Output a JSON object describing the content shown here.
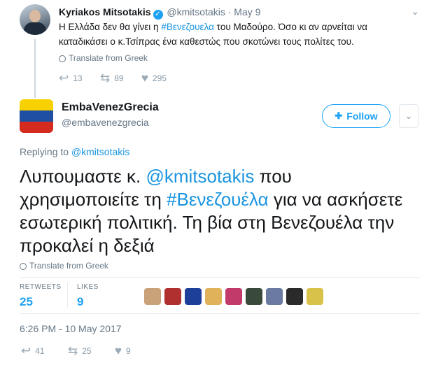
{
  "parent_tweet": {
    "display_name": "Kyriakos Mitsotakis",
    "handle": "@kmitsotakis",
    "separator": "·",
    "date": "May 9",
    "text_before_hashtag": "Η Ελλάδα δεν θα γίνει η ",
    "hashtag": "#Βενεζουελα",
    "text_after_hashtag": " του Μαδούρο. Όσο κι αν αρνείται να καταδικάσει ο κ.Τσίπρας ένα καθεστώς που σκοτώνει τους πολίτες του.",
    "translate": "Translate from Greek",
    "replies": "13",
    "retweets": "89",
    "likes": "295"
  },
  "main_tweet": {
    "display_name": "EmbaVenezGrecia",
    "handle": "@embavenezgrecia",
    "follow_label": "Follow",
    "replying_prefix": "Replying to ",
    "replying_handle": "@kmitsotakis",
    "text_part1": "Λυπουμαστε κ. ",
    "mention": "@kmitsotakis",
    "text_part2": " που χρησιμοποιείτε τη ",
    "hashtag": "#Βενεζουέλα",
    "text_part3": " για να ασκήσετε εσωτερική πολιτική. Τη βία στη Βενεζουέλα την προκαλεί η δεξιά",
    "translate": "Translate from Greek",
    "retweets_label": "RETWEETS",
    "retweets_value": "25",
    "likes_label": "LIKES",
    "likes_value": "9",
    "timestamp": "6:26 PM - 10 May 2017",
    "action_replies": "41",
    "action_retweets": "25",
    "action_likes": "9"
  },
  "likers": [
    {
      "name": "liker-1",
      "color": "#c9a27a"
    },
    {
      "name": "liker-2",
      "color": "#b03030"
    },
    {
      "name": "liker-3",
      "color": "#1d3f9a"
    },
    {
      "name": "liker-4",
      "color": "#e0b25a"
    },
    {
      "name": "liker-5",
      "color": "#c23a6a"
    },
    {
      "name": "liker-6",
      "color": "#3a4a3a"
    },
    {
      "name": "liker-7",
      "color": "#6a7aa0"
    },
    {
      "name": "liker-8",
      "color": "#2a2a2a"
    },
    {
      "name": "liker-9",
      "color": "#d8c24a"
    }
  ],
  "colors": {
    "accent": "#1da1f2",
    "link": "#1b95e0",
    "muted": "#657786"
  }
}
